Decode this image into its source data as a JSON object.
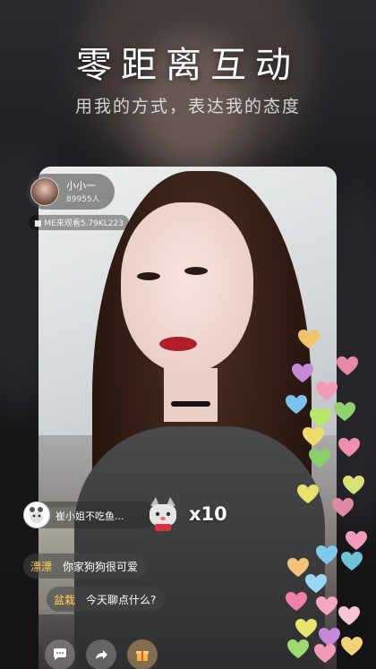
{
  "promo": {
    "headline": "零距离互动",
    "subline": "用我的方式，表达我的态度"
  },
  "anchor": {
    "name": "小小一",
    "followers": "89955人",
    "room_id": "ME来观看5.79KL223"
  },
  "gift": {
    "sender": "崔小姐不吃鱼...",
    "multiplier": "x10"
  },
  "chat": [
    {
      "user": "漂漂",
      "message": "你家狗狗很可爱"
    },
    {
      "user": "盆栽",
      "message": "今天聊点什么?"
    }
  ],
  "icons": {
    "bottom_buttons": [
      "chat-bubble-icon",
      "share-icon",
      "gift-box-icon"
    ]
  },
  "colors": {
    "username": "#ffd34e",
    "background": "#1a1a1d"
  }
}
